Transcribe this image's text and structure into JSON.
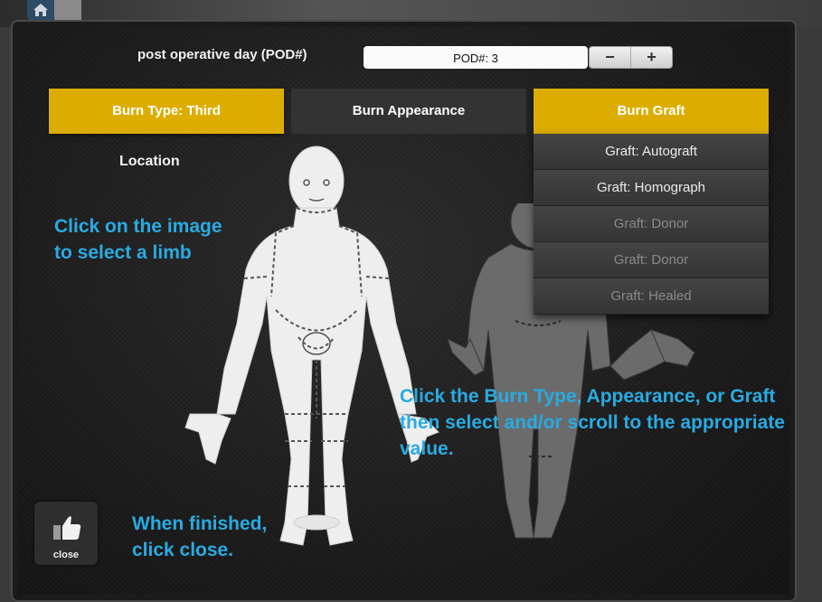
{
  "header": {
    "pod_label": "post operative day (POD#)",
    "pod_value": "POD#: 3",
    "minus_label": "−",
    "plus_label": "+"
  },
  "tabs": [
    {
      "label": "Burn Type: Third",
      "active": true
    },
    {
      "label": "Burn Appearance",
      "active": false
    },
    {
      "label": "Burn Graft",
      "active": true
    }
  ],
  "location_label": "Location",
  "graft_options": [
    {
      "label": "Graft: Autograft",
      "enabled": true
    },
    {
      "label": "Graft: Homograph",
      "enabled": true
    },
    {
      "label": "Graft: Donor",
      "enabled": false
    },
    {
      "label": "Graft: Donor",
      "enabled": false
    },
    {
      "label": "Graft: Healed",
      "enabled": false
    }
  ],
  "instructions": {
    "select_limb": [
      "Click on the image",
      "to select a limb"
    ],
    "burn_type": [
      "Click the Burn Type, Appearance, or Graft",
      "then select and/or scroll to the appropriate",
      "value."
    ],
    "finished": [
      "When finished,",
      "click close."
    ]
  },
  "close_button": {
    "label": "close",
    "icon": "thumbs-up-icon"
  },
  "colors": {
    "accent_gold": "#dcad00",
    "instruction_blue": "#29abe2"
  }
}
